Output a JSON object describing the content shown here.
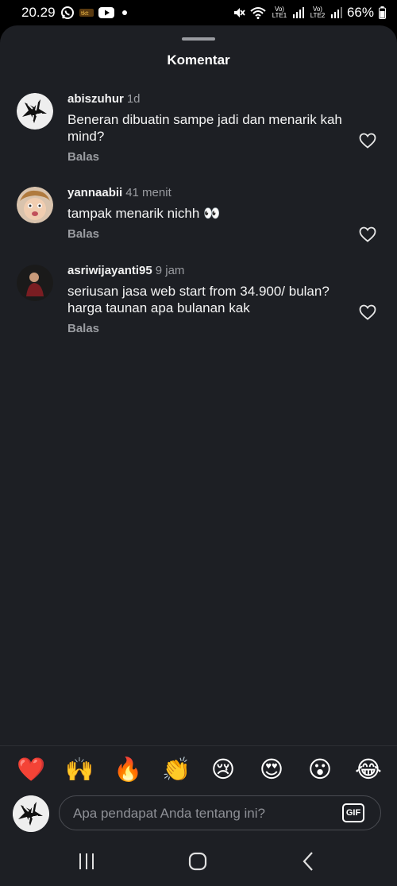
{
  "status_bar": {
    "time": "20.29",
    "sim1_label": "Vo) LTE1",
    "sim2_label": "Vo) LTE2",
    "battery": "66%",
    "icons": [
      "whatsapp-icon",
      "app-icon",
      "youtube-icon",
      "notification-dot",
      "mute-icon",
      "wifi-icon",
      "signal-icon",
      "battery-icon"
    ]
  },
  "sheet": {
    "title": "Komentar"
  },
  "comments": [
    {
      "username": "abiszuhur",
      "time": "1d",
      "text": "Beneran dibuatin sampe jadi dan menarik kah mind?",
      "reply_label": "Balas"
    },
    {
      "username": "yannaabii",
      "time": "41 menit",
      "text": "tampak menarik nichh 👀",
      "reply_label": "Balas"
    },
    {
      "username": "asriwijayanti95",
      "time": "9 jam",
      "text": "seriusan jasa web start from 34.900/ bulan? harga taunan apa bulanan kak",
      "reply_label": "Balas"
    }
  ],
  "emoji_bar": [
    "❤️",
    "🙌",
    "🔥",
    "👏",
    "😢",
    "😍",
    "😮",
    "😂"
  ],
  "composer": {
    "placeholder": "Apa pendapat Anda tentang ini?",
    "gif_label": "GIF"
  },
  "nav_bar": {
    "buttons": [
      "recents-icon",
      "home-icon",
      "back-icon"
    ]
  },
  "colors": {
    "sheet_bg": "#1d1f24",
    "muted_text": "#9a9ca1",
    "status_bg": "#000000"
  }
}
